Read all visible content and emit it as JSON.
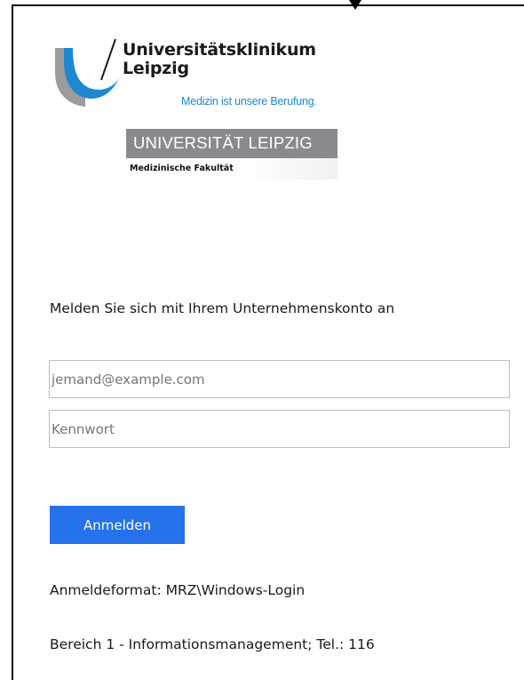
{
  "logos": {
    "ukl": {
      "name_line1": "Universitätsklinikum",
      "name_line2": "Leipzig",
      "slogan": "Medizin ist unsere Berufung.",
      "colors": {
        "grey": "#9b9c9f",
        "blue": "#1e88d1",
        "text": "#1a1a1a"
      }
    },
    "uni": {
      "name": "UNIVERSITÄT LEIPZIG",
      "faculty": "Medizinische Fakultät",
      "colors": {
        "band": "#888a8d"
      }
    }
  },
  "login": {
    "heading": "Melden Sie sich mit Ihrem Unternehmenskonto an",
    "username": {
      "value": "",
      "placeholder": "jemand@example.com"
    },
    "password": {
      "value": "",
      "placeholder": "Kennwort"
    },
    "submit_label": "Anmelden",
    "accent_color": "#2672ec"
  },
  "footer": {
    "format_hint": "Anmeldeformat: MRZ\\Windows-Login",
    "contact": "Bereich 1 - Informationsmanagement; Tel.: 116"
  }
}
